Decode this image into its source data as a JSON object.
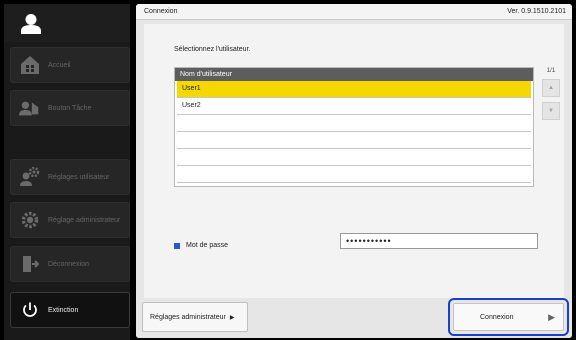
{
  "sidebar": {
    "items": [
      {
        "label": "Accueil",
        "icon": "home-icon"
      },
      {
        "label": "Bouton Tâche",
        "icon": "task-users-icon"
      },
      {
        "label": "Réglages utilisateur",
        "icon": "user-settings-icon"
      },
      {
        "label": "Réglage administrateur",
        "icon": "admin-settings-icon"
      },
      {
        "label": "Déconnexion",
        "icon": "logout-icon"
      },
      {
        "label": "Extinction",
        "icon": "power-icon"
      }
    ]
  },
  "header": {
    "title": "Connexion",
    "version": "Ver. 0.9.1510.2101"
  },
  "main": {
    "instruction": "Sélectionnez l'utilisateur.",
    "table": {
      "column_header": "Nom d'utilisateur",
      "rows": [
        "User1",
        "User2",
        "",
        "",
        "",
        "",
        ""
      ],
      "selected_index": 0
    },
    "pager": {
      "page": "1/1"
    },
    "password": {
      "label": "Mot de passe",
      "value": "•••••••••••"
    }
  },
  "footer": {
    "admin_button": "Réglages administrateur",
    "connect_button": "Connexion"
  },
  "colors": {
    "selected_row": "#f6d800",
    "highlight_frame": "#1940c8",
    "password_marker": "#2a57d6"
  }
}
